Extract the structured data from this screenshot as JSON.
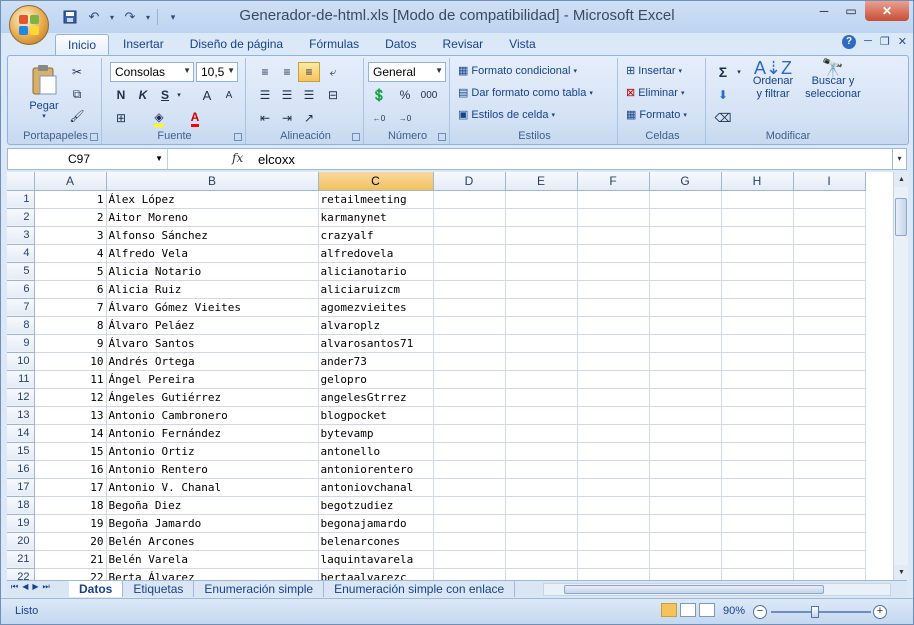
{
  "title": "Generador-de-html.xls  [Modo de compatibilidad]  -  Microsoft Excel",
  "qat": {
    "save_icon": "save-icon",
    "undo_icon": "undo-icon",
    "redo_icon": "redo-icon"
  },
  "tabs": [
    "Inicio",
    "Insertar",
    "Diseño de página",
    "Fórmulas",
    "Datos",
    "Revisar",
    "Vista"
  ],
  "ribbon": {
    "portapapeles": {
      "label": "Portapapeles",
      "paste": "Pegar"
    },
    "fuente": {
      "label": "Fuente",
      "font": "Consolas",
      "size": "10,5",
      "bold": "N",
      "italic": "K",
      "underline": "S",
      "grow": "A",
      "shrink": "A"
    },
    "alineacion": {
      "label": "Alineación"
    },
    "numero": {
      "label": "Número",
      "format": "General",
      "percent": "%",
      "thousands": "000",
      "inc_decimal": ",0 ,00",
      "dec_decimal": ",00 ,0"
    },
    "estilos": {
      "label": "Estilos",
      "cond": "Formato condicional",
      "table": "Dar formato como tabla",
      "cell": "Estilos de celda"
    },
    "celdas": {
      "label": "Celdas",
      "insert": "Insertar",
      "delete": "Eliminar",
      "format": "Formato"
    },
    "modificar": {
      "label": "Modificar",
      "sum": "Σ",
      "sort1": "Ordenar",
      "sort2": "y filtrar",
      "find1": "Buscar y",
      "find2": "seleccionar"
    }
  },
  "formula_bar": {
    "name_box": "C97",
    "fx": "fx",
    "value": "elcoxx"
  },
  "columns": [
    "A",
    "B",
    "C",
    "D",
    "E",
    "F",
    "G",
    "H",
    "I"
  ],
  "rows": [
    {
      "r": "1",
      "a": "1",
      "b": "Álex López",
      "c": "retailmeeting"
    },
    {
      "r": "2",
      "a": "2",
      "b": "Aitor Moreno",
      "c": "karmanynet"
    },
    {
      "r": "3",
      "a": "3",
      "b": "Alfonso Sánchez",
      "c": "crazyalf"
    },
    {
      "r": "4",
      "a": "4",
      "b": "Alfredo Vela",
      "c": "alfredovela"
    },
    {
      "r": "5",
      "a": "5",
      "b": "Alicia Notario",
      "c": "alicianotario"
    },
    {
      "r": "6",
      "a": "6",
      "b": "Alicia Ruiz",
      "c": "aliciaruizcm"
    },
    {
      "r": "7",
      "a": "7",
      "b": "Álvaro Gómez Vieites",
      "c": "agomezvieites"
    },
    {
      "r": "8",
      "a": "8",
      "b": "Álvaro Peláez",
      "c": "alvaroplz"
    },
    {
      "r": "9",
      "a": "9",
      "b": "Álvaro Santos",
      "c": "alvarosantos71"
    },
    {
      "r": "10",
      "a": "10",
      "b": "Andrés Ortega",
      "c": "ander73"
    },
    {
      "r": "11",
      "a": "11",
      "b": "Ángel Pereira",
      "c": "gelopro"
    },
    {
      "r": "12",
      "a": "12",
      "b": "Ángeles Gutiérrez",
      "c": "angelesGtrrez"
    },
    {
      "r": "13",
      "a": "13",
      "b": "Antonio Cambronero",
      "c": "blogpocket"
    },
    {
      "r": "14",
      "a": "14",
      "b": "Antonio Fernández",
      "c": "bytevamp"
    },
    {
      "r": "15",
      "a": "15",
      "b": "Antonio Ortiz",
      "c": "antonello"
    },
    {
      "r": "16",
      "a": "16",
      "b": "Antonio Rentero",
      "c": "antoniorentero"
    },
    {
      "r": "17",
      "a": "17",
      "b": "Antonio V. Chanal",
      "c": "antoniovchanal"
    },
    {
      "r": "18",
      "a": "18",
      "b": "Begoña Diez",
      "c": "begotzudiez"
    },
    {
      "r": "19",
      "a": "19",
      "b": "Begoña Jamardo",
      "c": "begonajamardo"
    },
    {
      "r": "20",
      "a": "20",
      "b": "Belén Arcones",
      "c": "belenarcones"
    },
    {
      "r": "21",
      "a": "21",
      "b": "Belén Varela",
      "c": "laquintavarela"
    },
    {
      "r": "22",
      "a": "22",
      "b": "Berta Álvarez",
      "c": "bertaalvarezc"
    }
  ],
  "sheets": [
    "Datos",
    "Etiquetas",
    "Enumeración simple",
    "Enumeración simple con enlace"
  ],
  "status": {
    "ready": "Listo",
    "zoom": "90%"
  }
}
